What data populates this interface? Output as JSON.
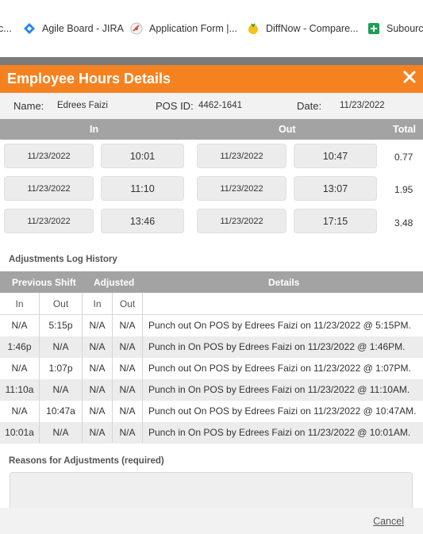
{
  "bookmarks": [
    {
      "label": "c...",
      "icon": "partial-bookmark-icon"
    },
    {
      "label": "Agile Board - JIRA",
      "icon": "jira-icon"
    },
    {
      "label": "Application Form |...",
      "icon": "form-icon"
    },
    {
      "label": "DiffNow - Compare...",
      "icon": "diffnow-icon"
    },
    {
      "label": "Subourc",
      "icon": "sheets-icon"
    }
  ],
  "modal": {
    "title": "Employee Hours Details",
    "name_label": "Name:",
    "name_value": "Edrees Faizi",
    "pos_label": "POS ID:",
    "pos_value": "4462-1641",
    "date_label": "Date:",
    "date_value": "11/23/2022"
  },
  "punch_headers": {
    "in": "In",
    "out": "Out",
    "total": "Total"
  },
  "punches": [
    {
      "in_date": "11/23/2022",
      "in_time": "10:01",
      "out_date": "11/23/2022",
      "out_time": "10:47",
      "total": "0.77"
    },
    {
      "in_date": "11/23/2022",
      "in_time": "11:10",
      "out_date": "11/23/2022",
      "out_time": "13:07",
      "total": "1.95"
    },
    {
      "in_date": "11/23/2022",
      "in_time": "13:46",
      "out_date": "11/23/2022",
      "out_time": "17:15",
      "total": "3.48"
    }
  ],
  "log": {
    "title": "Adjustments Log History",
    "head_previous": "Previous Shift",
    "head_adjusted": "Adjusted",
    "head_details": "Details",
    "sub_in": "In",
    "sub_out": "Out",
    "rows": [
      {
        "prev_in": "N/A",
        "prev_out": "5:15p",
        "adj_in": "N/A",
        "adj_out": "N/A",
        "details": "Punch out On POS by Edrees Faizi on 11/23/2022 @ 5:15PM."
      },
      {
        "prev_in": "1:46p",
        "prev_out": "N/A",
        "adj_in": "N/A",
        "adj_out": "N/A",
        "details": "Punch in On POS by Edrees Faizi on 11/23/2022 @ 1:46PM."
      },
      {
        "prev_in": "N/A",
        "prev_out": "1:07p",
        "adj_in": "N/A",
        "adj_out": "N/A",
        "details": "Punch out On POS by Edrees Faizi on 11/23/2022 @ 1:07PM."
      },
      {
        "prev_in": "11:10a",
        "prev_out": "N/A",
        "adj_in": "N/A",
        "adj_out": "N/A",
        "details": "Punch in On POS by Edrees Faizi on 11/23/2022 @ 11:10AM."
      },
      {
        "prev_in": "N/A",
        "prev_out": "10:47a",
        "adj_in": "N/A",
        "adj_out": "N/A",
        "details": "Punch out On POS by Edrees Faizi on 11/23/2022 @ 10:47AM."
      },
      {
        "prev_in": "10:01a",
        "prev_out": "N/A",
        "adj_in": "N/A",
        "adj_out": "N/A",
        "details": "Punch in On POS by Edrees Faizi on 11/23/2022 @ 10:01AM."
      }
    ]
  },
  "reasons_label": "Reasons for Adjustments (required)",
  "cancel_label": "Cancel",
  "colors": {
    "header_orange": "#f58220",
    "table_header_gray": "#a3a3a3"
  }
}
